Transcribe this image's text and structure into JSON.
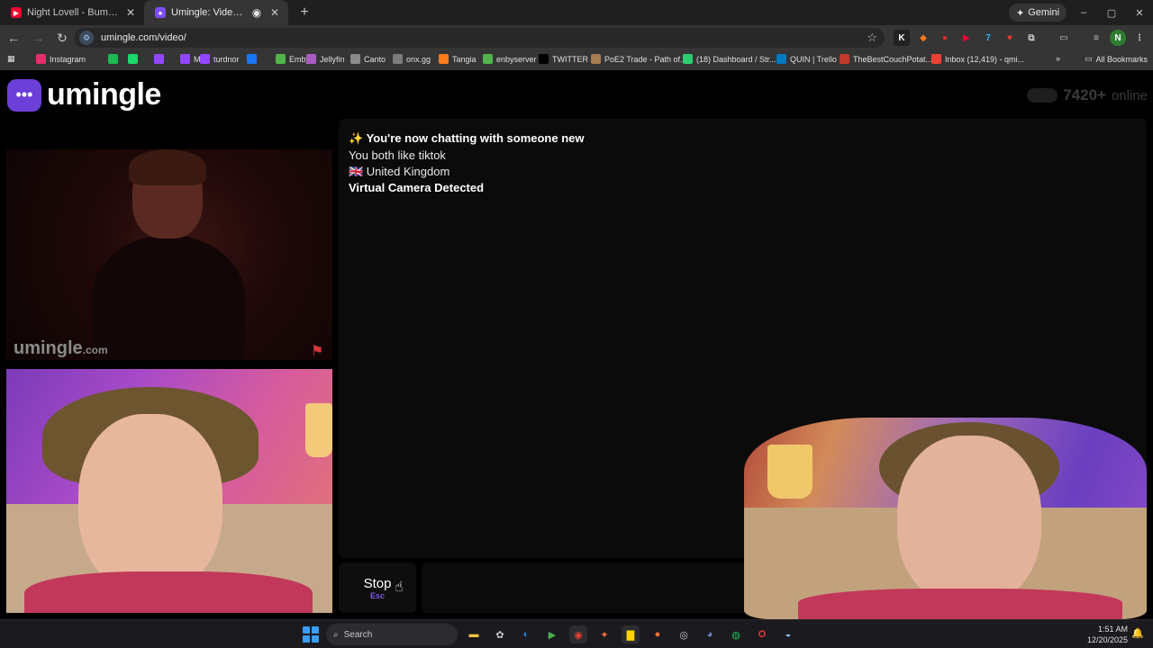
{
  "browser": {
    "tabs": [
      {
        "title": "Night Lovell - Bumblebee (KEIF",
        "fav_color": "#ff0033",
        "active": false
      },
      {
        "title": "Umingle: Video Chat with S",
        "fav_color": "#7c4dff",
        "active": true
      }
    ],
    "new_tab": "+",
    "gemini_label": "Gemini",
    "url": "umingle.com/video/",
    "window_controls": [
      "–",
      "▢",
      "✕"
    ]
  },
  "bookmarks": [
    {
      "label": "Instagram",
      "color": "#e1306c"
    },
    {
      "label": "",
      "color": "#1db954"
    },
    {
      "label": "",
      "color": "#1bd96a"
    },
    {
      "label": "",
      "color": "#9146ff"
    },
    {
      "label": "ME",
      "color": "#9146ff"
    },
    {
      "label": "turdnor",
      "color": "#9146ff"
    },
    {
      "label": "",
      "color": "#1877f2"
    },
    {
      "label": "Emby",
      "color": "#52b54b"
    },
    {
      "label": "Jellyfin",
      "color": "#aa5cc3"
    },
    {
      "label": "Canto",
      "color": "#8a8a8a"
    },
    {
      "label": "onx.gg",
      "color": "#7c7c7c"
    },
    {
      "label": "Tangia",
      "color": "#ff7a1a"
    },
    {
      "label": "enbyserver",
      "color": "#52b54b"
    },
    {
      "label": "TWITTER",
      "color": "#000000"
    },
    {
      "label": "PoE2 Trade - Path of...",
      "color": "#a67c52"
    },
    {
      "label": "(18) Dashboard / Str...",
      "color": "#2ecc71"
    },
    {
      "label": "QUIN | Trello",
      "color": "#0079bf"
    },
    {
      "label": "TheBestCouchPotat...",
      "color": "#c0392b"
    },
    {
      "label": "Inbox (12,419) - qmi...",
      "color": "#ea4335"
    }
  ],
  "all_bookmarks": "All Bookmarks",
  "site": {
    "logo_text": "umingle",
    "online_count": "7420+",
    "online_label": "online",
    "watermark": "umingle",
    "watermark_suffix": ".com"
  },
  "chat": {
    "messages": [
      {
        "text": "✨ You're now chatting with someone new",
        "bold": true
      },
      {
        "text": "You both like tiktok",
        "bold": false
      },
      {
        "text": "🇬🇧 United Kingdom",
        "bold": false
      },
      {
        "text": "Virtual Camera Detected",
        "bold": true
      }
    ]
  },
  "controls": {
    "stop_label": "Stop",
    "stop_key": "Esc"
  },
  "taskbar": {
    "search_placeholder": "Search",
    "time": "1:51 AM",
    "date": "12/20/2025"
  }
}
